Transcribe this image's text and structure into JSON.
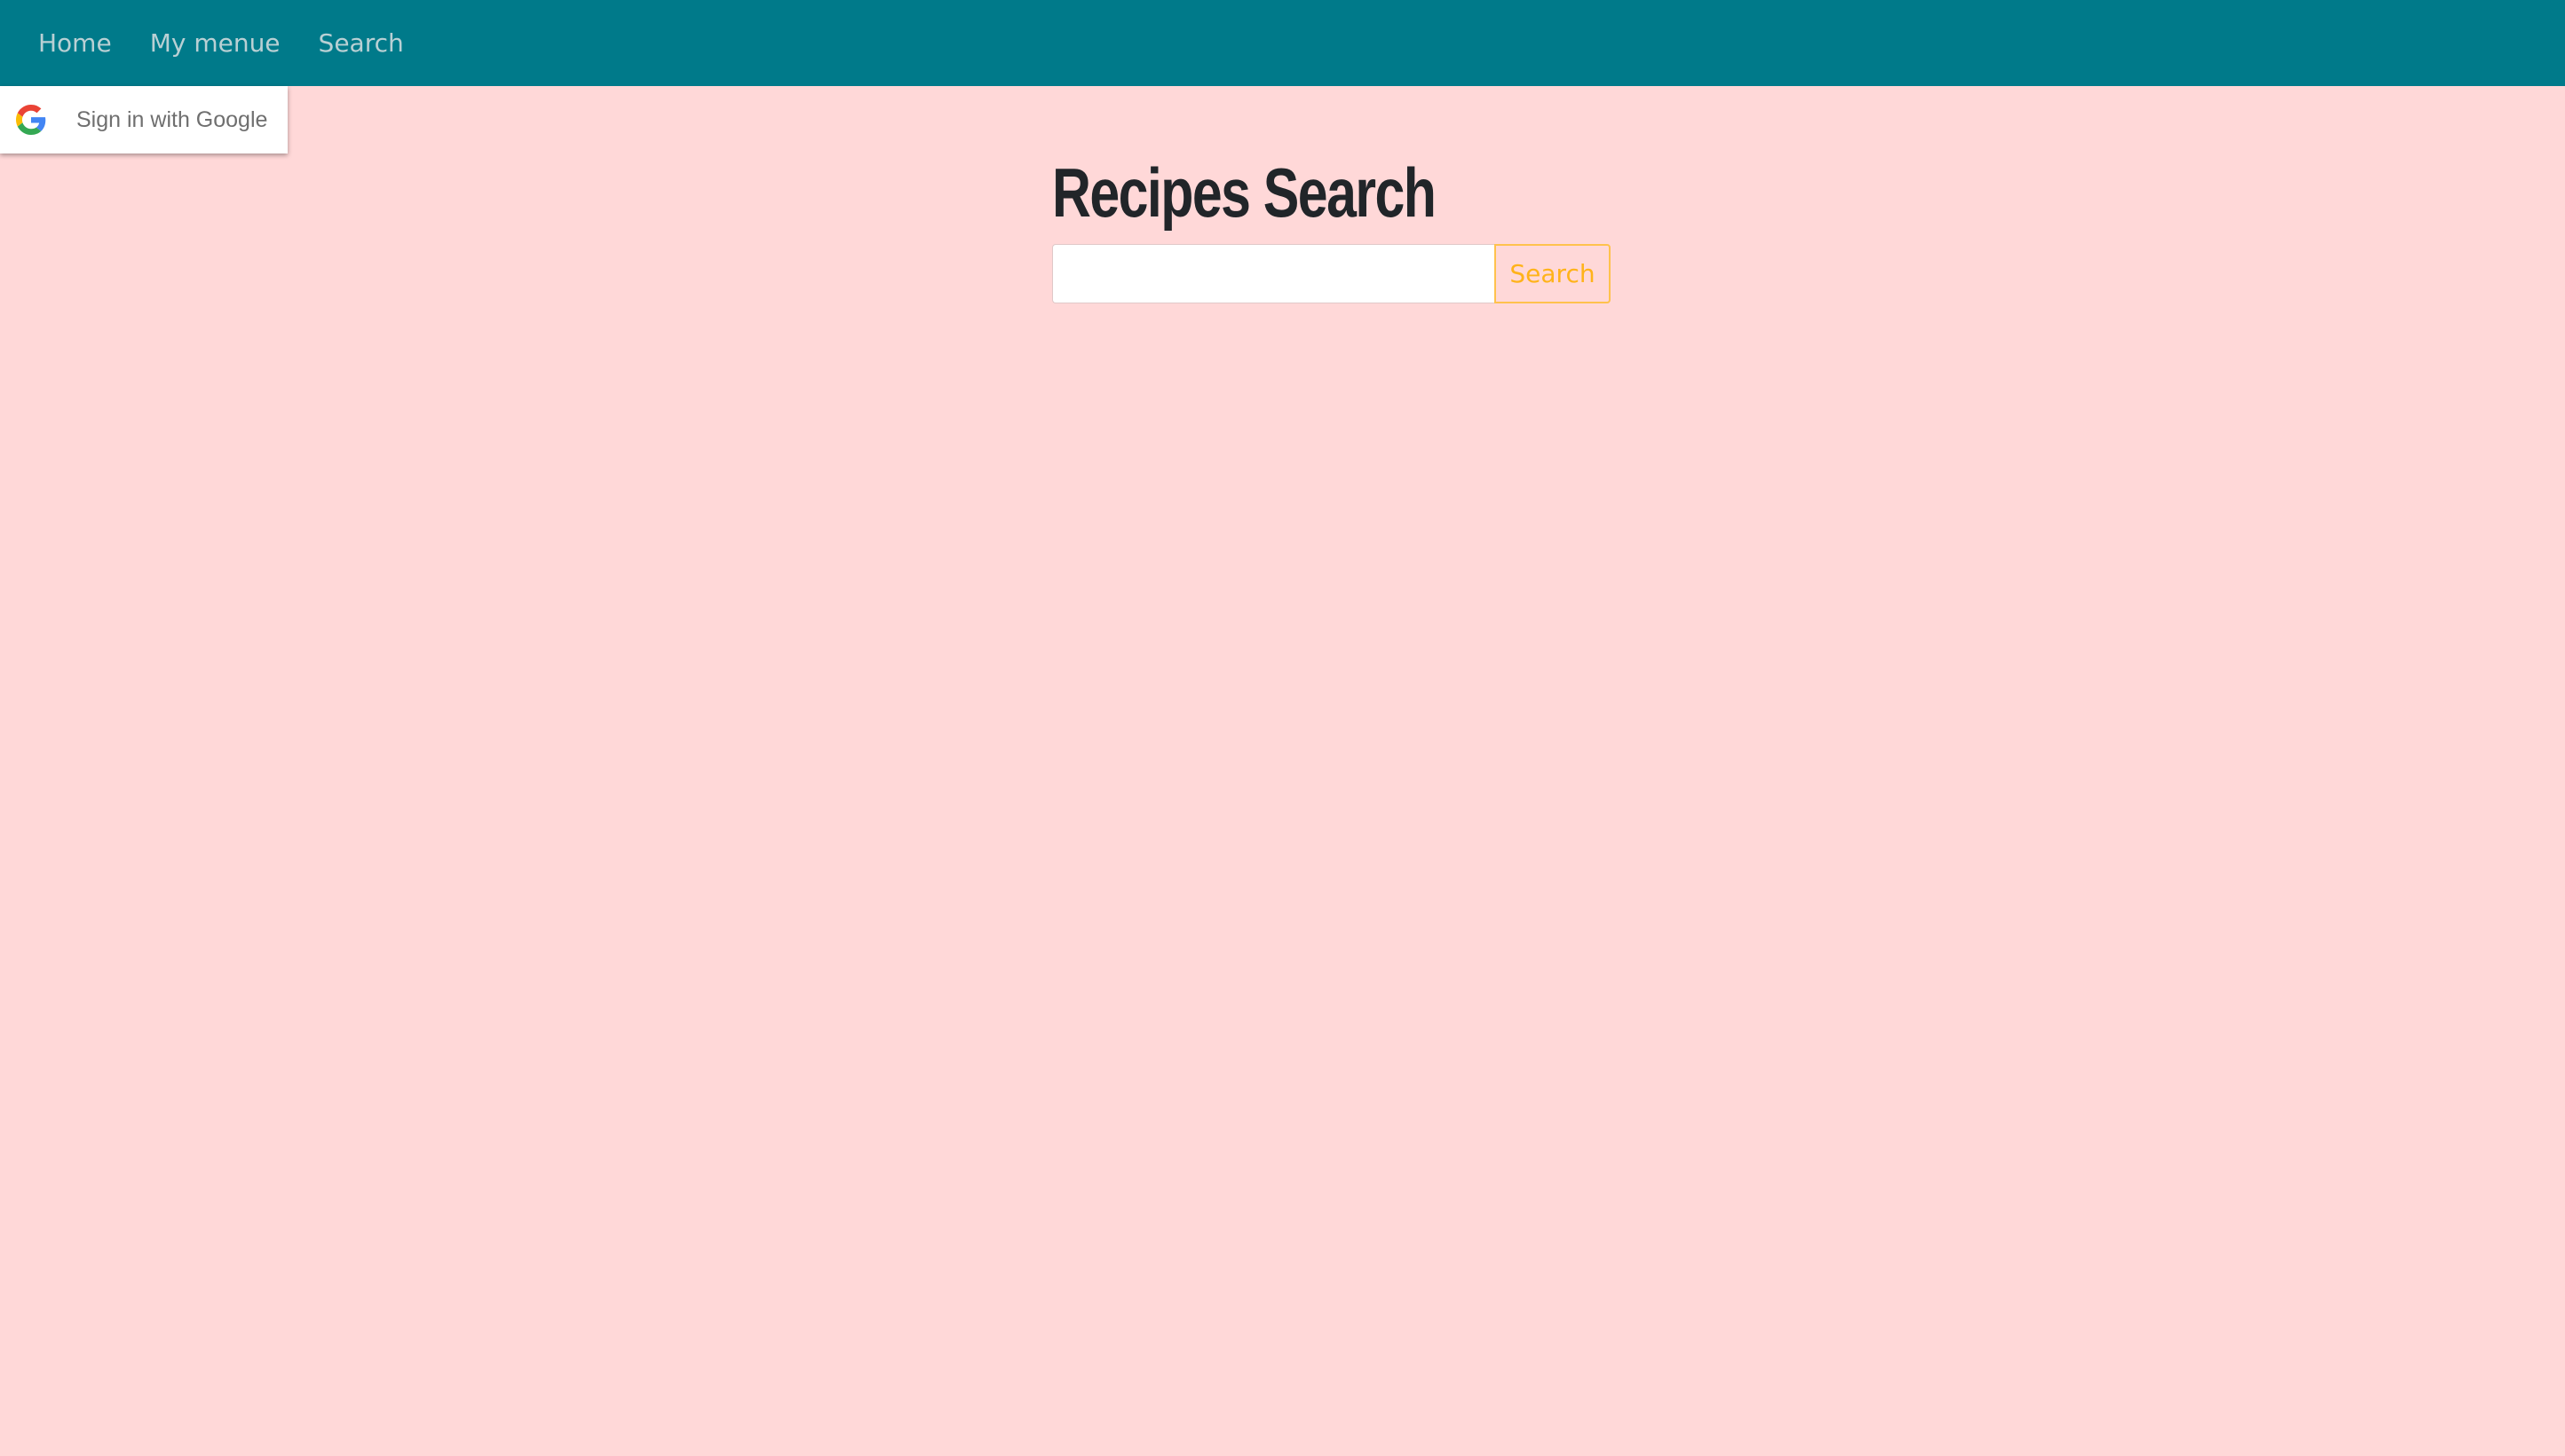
{
  "navbar": {
    "background": "#007a8a",
    "items": [
      {
        "label": "Home"
      },
      {
        "label": "My menue"
      },
      {
        "label": "Search"
      }
    ]
  },
  "google_signin": {
    "label": "Sign in with Google",
    "icon": "google-icon"
  },
  "main": {
    "title": "Recipes Search",
    "search": {
      "value": "",
      "placeholder": "",
      "button_label": "Search"
    }
  },
  "colors": {
    "page_background": "#ffd8d8",
    "accent": "#ffb31a",
    "nav_text": "#b9d0d4"
  }
}
